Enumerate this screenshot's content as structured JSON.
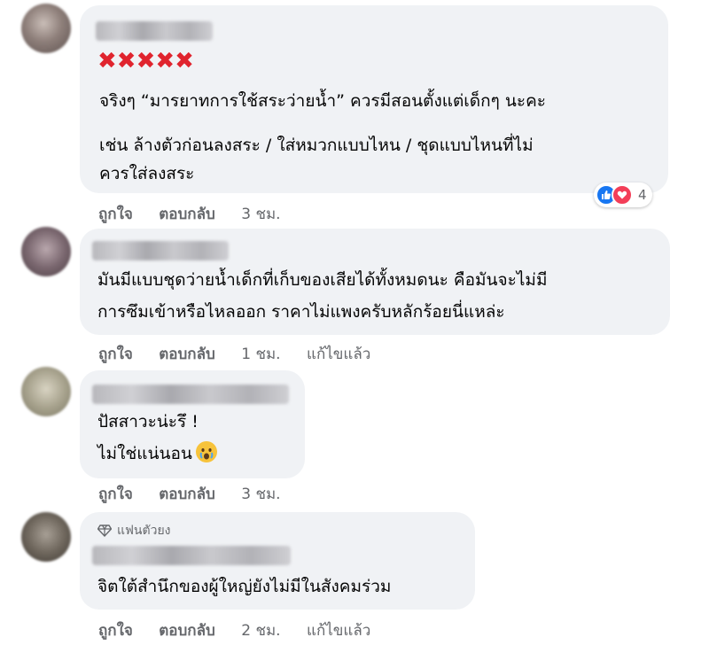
{
  "comments": [
    {
      "lines": [
        "จริงๆ “มารยาทการใช้สระว่ายน้ำ” ควรมีสอนตั้งแต่เด็กๆ นะคะ",
        "เช่น ล้างตัวก่อนลงสระ / ใส่หมวกแบบไหน / ชุดแบบไหนที่ไม่",
        "ควรใส่ลงสระ"
      ],
      "marks": "✖✖✖✖✖",
      "like_label": "ถูกใจ",
      "reply_label": "ตอบกลับ",
      "time": "3 ชม.",
      "reaction_count": "4"
    },
    {
      "lines": [
        "มันมีแบบชุดว่ายน้ำเด็กที่เก็บของเสียได้ทั้งหมดนะ คือมันจะไม่มี",
        "การซึมเข้าหรือไหลออก ราคาไม่แพงครับหลักร้อยนี่แหล่ะ"
      ],
      "like_label": "ถูกใจ",
      "reply_label": "ตอบกลับ",
      "time": "1 ชม.",
      "edited": "แก้ไขแล้ว"
    },
    {
      "lines": [
        "ปัสสาวะน่ะรึ !",
        "ไม่ใช่แน่นอน"
      ],
      "emoji": "crying-face-emoji",
      "like_label": "ถูกใจ",
      "reply_label": "ตอบกลับ",
      "time": "3 ชม."
    },
    {
      "badge": "แฟนตัวยง",
      "lines": [
        "จิตใต้สำนึกของผู้ใหญ่ยังไม่มีในสังคมร่วม"
      ],
      "like_label": "ถูกใจ",
      "reply_label": "ตอบกลับ",
      "time": "2 ชม.",
      "edited": "แก้ไขแล้ว"
    }
  ],
  "colors": {
    "bubble": "#f0f2f5",
    "meta": "#65676b",
    "like_blue": "#1877f2",
    "love_red": "#f33e58",
    "marks_red": "#e0242e"
  }
}
